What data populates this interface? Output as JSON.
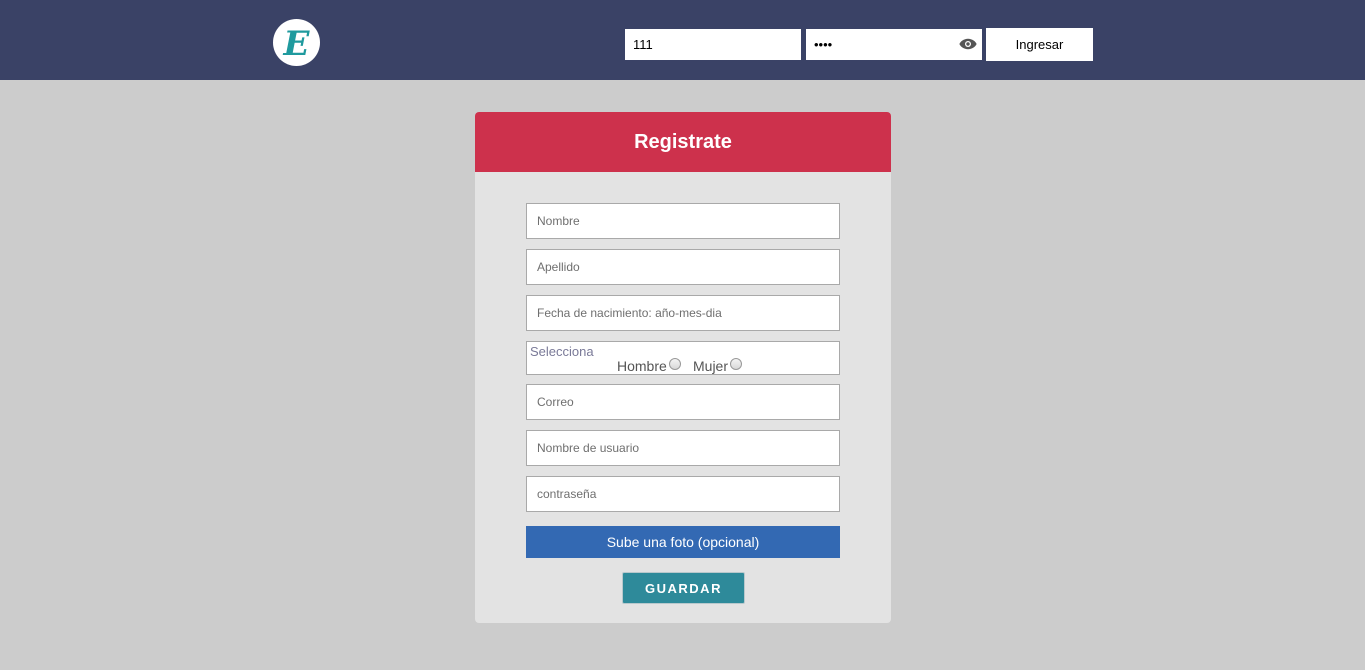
{
  "header": {
    "logo_letter": "E",
    "login": {
      "username_value": "111",
      "password_value": "••••",
      "submit_label": "Ingresar"
    }
  },
  "register": {
    "title": "Registrate",
    "fields": {
      "nombre": "Nombre",
      "apellido": "Apellido",
      "fecha": "Fecha de nacimiento: año-mes-dia",
      "correo": "Correo",
      "usuario": "Nombre de usuario",
      "contrasena": "contraseña"
    },
    "gender": {
      "title": "Selecciona",
      "male": "Hombre",
      "female": "Mujer"
    },
    "upload_label": "Sube una foto (opcional)",
    "save_label": "GUARDAR"
  },
  "colors": {
    "topbar": "#3a4266",
    "card_header": "#cd314c",
    "upload_button": "#3369b3",
    "save_button": "#2e8a9a",
    "logo_letter": "#1f9a9e"
  },
  "icons": {
    "password_toggle": "eye-icon"
  }
}
